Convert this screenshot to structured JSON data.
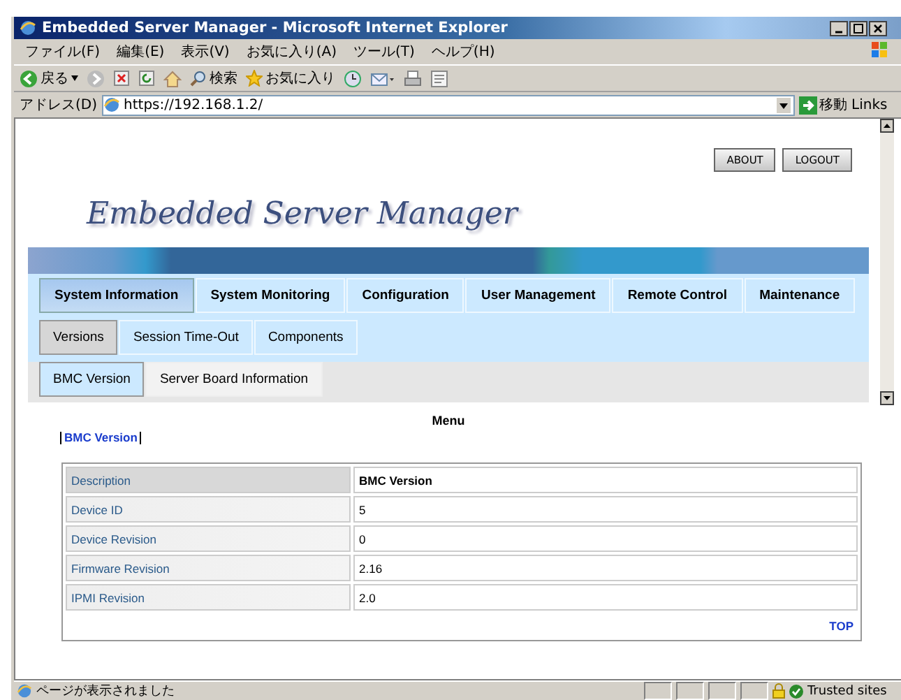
{
  "window": {
    "title": "Embedded Server Manager - Microsoft Internet Explorer"
  },
  "menu": [
    "ファイル(F)",
    "編集(E)",
    "表示(V)",
    "お気に入り(A)",
    "ツール(T)",
    "ヘルプ(H)"
  ],
  "toolbar": {
    "back": "戻る",
    "search": "検索",
    "favorites": "お気に入り"
  },
  "address_bar": {
    "label": "アドレス(D)",
    "value": "https://192.168.1.2/",
    "go": "移動",
    "links": "Links"
  },
  "page": {
    "buttons": [
      "ABOUT",
      "LOGOUT"
    ],
    "heading": "Embedded Server Manager",
    "tabs": [
      {
        "label": "System Information",
        "selected": true
      },
      {
        "label": "System Monitoring",
        "selected": false
      },
      {
        "label": "Configuration",
        "selected": false
      },
      {
        "label": "User Management",
        "selected": false
      },
      {
        "label": "Remote Control",
        "selected": false
      },
      {
        "label": "Maintenance",
        "selected": false
      }
    ],
    "subtabs": [
      {
        "label": "Versions",
        "selected": true
      },
      {
        "label": "Session Time-Out",
        "selected": false
      },
      {
        "label": "Components",
        "selected": false
      }
    ],
    "subsubtabs": [
      {
        "label": "BMC Version",
        "selected": true
      },
      {
        "label": "Server Board Information",
        "selected": false
      }
    ],
    "menu_title": "Menu",
    "menu_links": [
      "BMC Version"
    ],
    "table": {
      "header": [
        "Description",
        "BMC Version"
      ],
      "rows": [
        [
          "Device ID",
          "5"
        ],
        [
          "Device Revision",
          "0"
        ],
        [
          "Firmware Revision",
          "2.16"
        ],
        [
          "IPMI Revision",
          "2.0"
        ]
      ],
      "top_link": "TOP"
    }
  },
  "status_bar": {
    "text": "ページが表示されました",
    "zone": "Trusted sites"
  }
}
